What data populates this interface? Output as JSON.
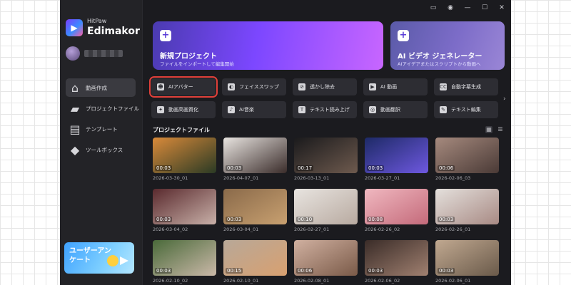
{
  "app": {
    "brand": "HitPaw",
    "product": "Edimakor",
    "logo_glyph": "▶"
  },
  "titlebar": {
    "icons": [
      "feedback-icon",
      "info-icon",
      "minimize-icon",
      "maximize-icon",
      "close-icon"
    ],
    "glyphs": [
      "▭",
      "◉",
      "—",
      "☐",
      "✕"
    ]
  },
  "sidebar": {
    "items": [
      {
        "label": "動画作成",
        "icon": "home-icon",
        "glyph": "⌂",
        "active": true
      },
      {
        "label": "プロジェクトファイル",
        "icon": "folder-icon",
        "glyph": "▰",
        "active": false
      },
      {
        "label": "テンプレート",
        "icon": "template-icon",
        "glyph": "▤",
        "active": false
      },
      {
        "label": "ツールボックス",
        "icon": "toolbox-icon",
        "glyph": "◆",
        "active": false
      }
    ],
    "survey": {
      "label": "ユーザーアンケート"
    }
  },
  "hero": {
    "new_project": {
      "title": "新規プロジェクト",
      "subtitle": "ファイルをインポートして編集開始"
    },
    "ai_video": {
      "title": "AI ビデオ ジェネレーター",
      "subtitle": "AIアイデアまたはスクリプトから動画へ"
    }
  },
  "tools": [
    {
      "label": "AIアバター",
      "icon": "avatar-icon",
      "glyph": "☻",
      "highlight": true
    },
    {
      "label": "フェイススワップ",
      "icon": "face-swap-icon",
      "glyph": "◐"
    },
    {
      "label": "透かし除去",
      "icon": "watermark-remove-icon",
      "glyph": "⊘"
    },
    {
      "label": "AI 動画",
      "icon": "ai-video-icon",
      "glyph": "▶"
    },
    {
      "label": "自動字幕生成",
      "icon": "subtitle-icon",
      "glyph": "CC"
    },
    {
      "label": "動画高画質化",
      "icon": "enhance-icon",
      "glyph": "✦"
    },
    {
      "label": "AI音楽",
      "icon": "music-icon",
      "glyph": "♪"
    },
    {
      "label": "テキスト読み上げ",
      "icon": "tts-icon",
      "glyph": "T"
    },
    {
      "label": "動画翻訳",
      "icon": "translate-icon",
      "glyph": "◎"
    },
    {
      "label": "テキスト編集",
      "icon": "text-edit-icon",
      "glyph": "✎"
    }
  ],
  "projects": {
    "title": "プロジェクトファイル",
    "view_glyphs": [
      "▦",
      "☰"
    ],
    "items": [
      {
        "name": "2026-03-30_01",
        "duration": "00:03",
        "color_a": "#d98a3a",
        "color_b": "#2a3a24"
      },
      {
        "name": "2026-04-07_01",
        "duration": "00:03",
        "color_a": "#e8e4e0",
        "color_b": "#3a2c2a"
      },
      {
        "name": "2026-03-13_01",
        "duration": "00:17",
        "color_a": "#1a1a1c",
        "color_b": "#6e5a4e"
      },
      {
        "name": "2026-03-27_01",
        "duration": "00:03",
        "color_a": "#1d2a66",
        "color_b": "#6e58e0"
      },
      {
        "name": "2026-02-06_03",
        "duration": "00:06",
        "color_a": "#a68a7e",
        "color_b": "#4a3a36"
      },
      {
        "name": "2026-03-04_02",
        "duration": "00:03",
        "color_a": "#5a2a2e",
        "color_b": "#c8b0a8"
      },
      {
        "name": "2026-03-04_01",
        "duration": "00:03",
        "color_a": "#8a6a4a",
        "color_b": "#c8a070"
      },
      {
        "name": "2026-02-27_01",
        "duration": "00:10",
        "color_a": "#e8e4e0",
        "color_b": "#b8aaa0"
      },
      {
        "name": "2026-02-26_02",
        "duration": "00:08",
        "color_a": "#f0b8c0",
        "color_b": "#c46a7a"
      },
      {
        "name": "2026-02-26_01",
        "duration": "00:03",
        "color_a": "#e4e0dc",
        "color_b": "#a88a84"
      },
      {
        "name": "2026-02-10_02",
        "duration": "00:03",
        "color_a": "#4a6a3a",
        "color_b": "#cab8a8"
      },
      {
        "name": "2026-02-10_01",
        "duration": "00:15",
        "color_a": "#b8a898",
        "color_b": "#d8a070"
      },
      {
        "name": "2026-02-08_01",
        "duration": "00:06",
        "color_a": "#d0b0a0",
        "color_b": "#7a5a48"
      },
      {
        "name": "2026-02-06_02",
        "duration": "00:03",
        "color_a": "#3a2c28",
        "color_b": "#a08070"
      },
      {
        "name": "2026-02-06_01",
        "duration": "00:03",
        "color_a": "#c0a890",
        "color_b": "#6a5a4a"
      }
    ]
  }
}
